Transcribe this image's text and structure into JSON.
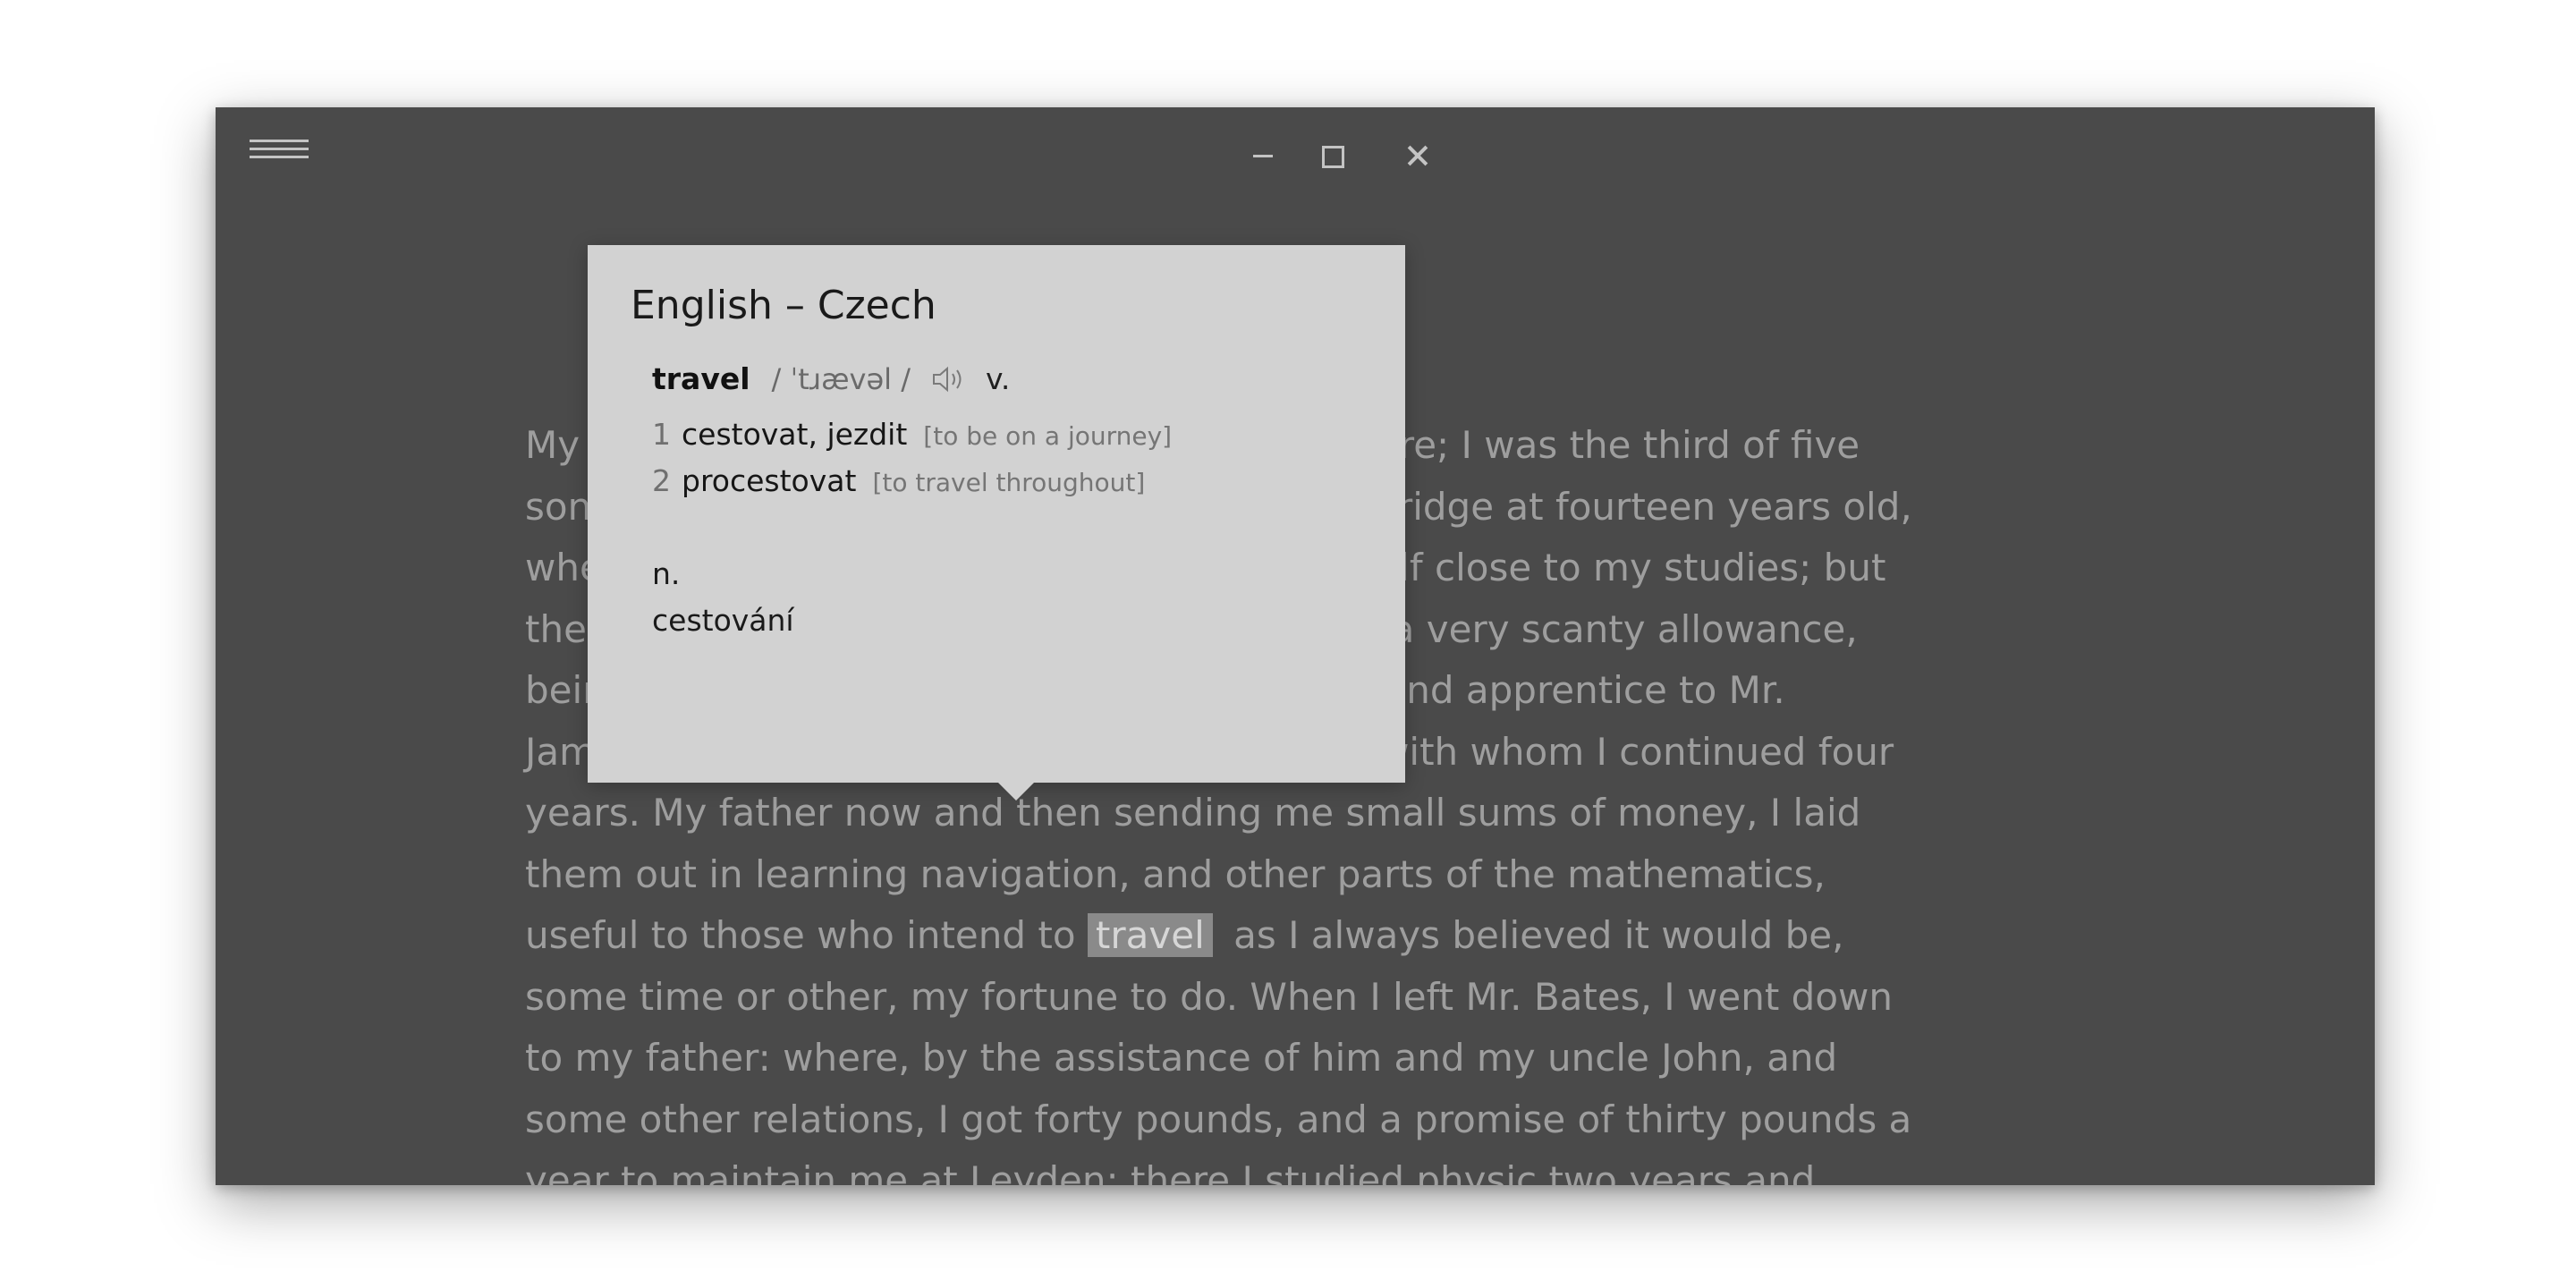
{
  "window": {
    "controls": {
      "menu": "menu",
      "minimize": "minimize",
      "maximize": "maximize",
      "close": "close"
    }
  },
  "reader": {
    "lines": [
      "My father had a small estate in Nottinghamshire; I was the third of five",
      "sons. He sent me to Emanuel College in Cambridge at fourteen years old,",
      "where I resided three years, and applied myself close to my studies; but",
      "the charge of maintaining me, although I had a very scanty allowance,",
      "being too great for a narrow fortune, I was bound apprentice to Mr.",
      "James Bates, an eminent surgeon in London, with whom I continued four",
      "years. My father now and then sending me small sums of money, I laid",
      "them out in learning navigation, and other parts of the mathematics,"
    ],
    "highlight_line": {
      "before": "useful to those who intend to ",
      "word": "travel",
      "after": " as I always believed it would be,"
    },
    "lines_after": [
      "some time or other, my fortune to do. When I left Mr. Bates, I went down",
      "to my father: where, by the assistance of him and my uncle John, and",
      "some other relations, I got forty pounds, and a promise of thirty pounds a",
      "year to maintain me at Leyden: there I studied physic two years and"
    ]
  },
  "popup": {
    "title": "English – Czech",
    "headword": "travel",
    "phonetic": "/ ˈtɹævəl /",
    "speaker_icon": "speaker-icon",
    "pos1": "v.",
    "senses": [
      {
        "num": "1",
        "translation": "cestovat, jezdit",
        "gloss": "[to be on a journey]"
      },
      {
        "num": "2",
        "translation": "procestovat",
        "gloss": "[to travel throughout]"
      }
    ],
    "pos2": "n.",
    "noun_translation": "cestování"
  }
}
